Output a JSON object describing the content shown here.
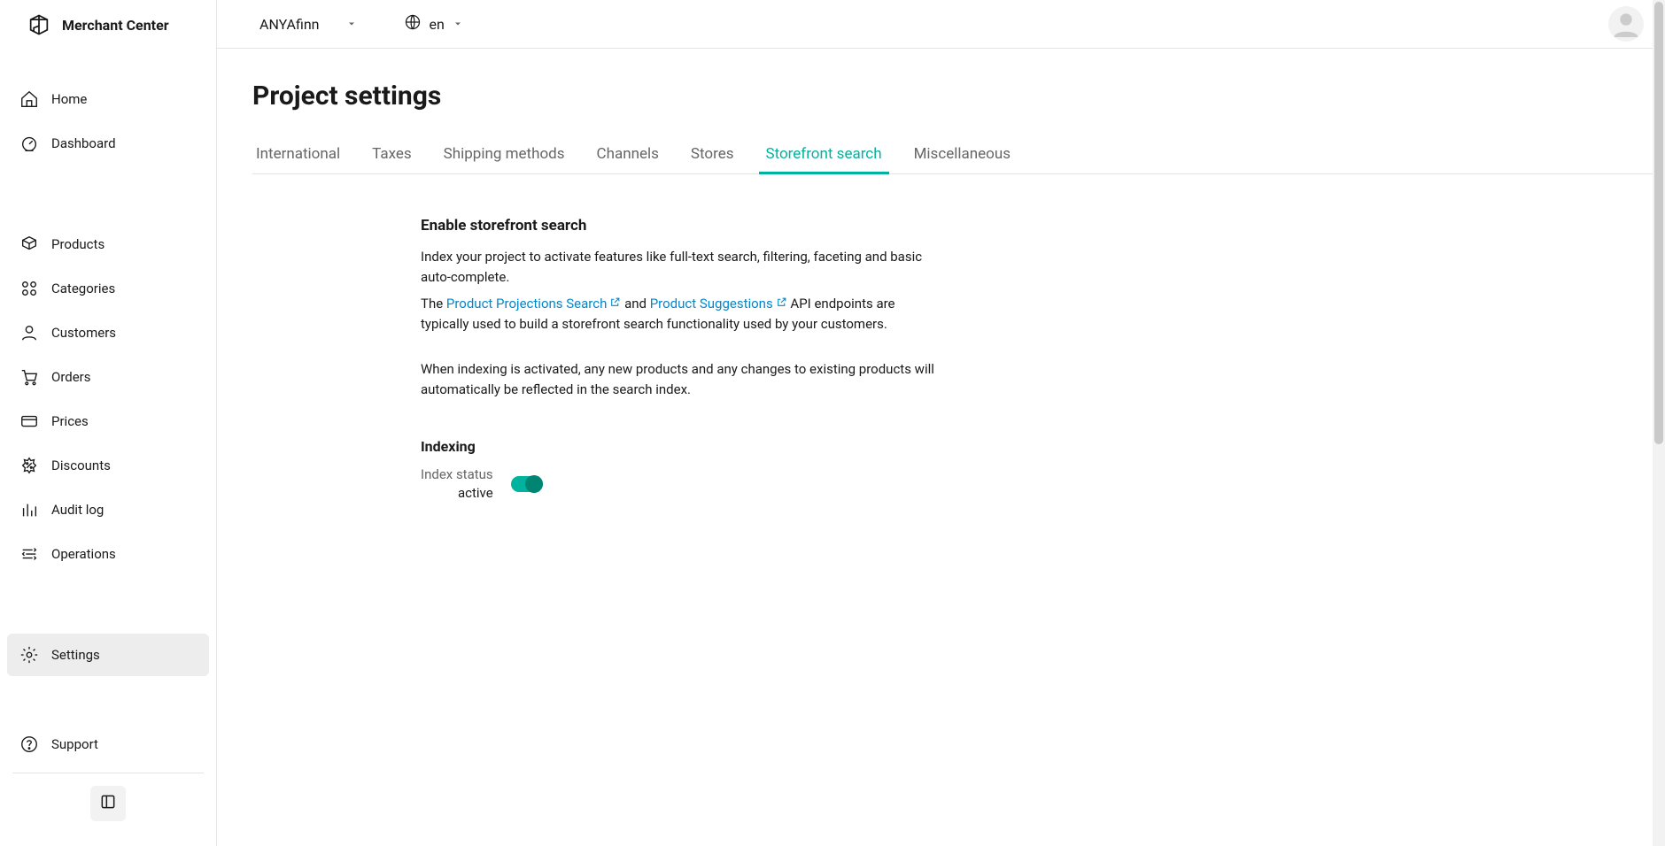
{
  "brand": "Merchant Center",
  "project_switcher": {
    "name": "ANYAfinn"
  },
  "lang_switcher": {
    "label": "en"
  },
  "sidebar": {
    "items": [
      {
        "icon": "home-icon",
        "label": "Home"
      },
      {
        "icon": "dashboard-icon",
        "label": "Dashboard"
      },
      {
        "icon": "products-icon",
        "label": "Products"
      },
      {
        "icon": "categories-icon",
        "label": "Categories"
      },
      {
        "icon": "customers-icon",
        "label": "Customers"
      },
      {
        "icon": "orders-icon",
        "label": "Orders"
      },
      {
        "icon": "prices-icon",
        "label": "Prices"
      },
      {
        "icon": "discounts-icon",
        "label": "Discounts"
      },
      {
        "icon": "audit-icon",
        "label": "Audit log"
      },
      {
        "icon": "operations-icon",
        "label": "Operations"
      },
      {
        "icon": "settings-icon",
        "label": "Settings",
        "active": true
      }
    ],
    "support_label": "Support"
  },
  "page": {
    "title": "Project settings",
    "tabs": [
      {
        "label": "International"
      },
      {
        "label": "Taxes"
      },
      {
        "label": "Shipping methods"
      },
      {
        "label": "Channels"
      },
      {
        "label": "Stores"
      },
      {
        "label": "Storefront search",
        "active": true
      },
      {
        "label": "Miscellaneous"
      }
    ],
    "section_title": "Enable storefront search",
    "p1": "Index your project to activate features like full-text search, filtering, faceting and basic auto-complete.",
    "p2_prefix": "The ",
    "link1": "Product Projections Search",
    "p2_mid": " and ",
    "link2": "Product Suggestions",
    "p2_suffix": " API endpoints are typically used to build a storefront search functionality used by your customers.",
    "p3": "When indexing is activated, any new products and any changes to existing products will automatically be reflected in the search index.",
    "indexing_heading": "Indexing",
    "indexing_status_label": "Index status",
    "indexing_status_value": "active"
  },
  "colors": {
    "accent": "#00b39e"
  }
}
